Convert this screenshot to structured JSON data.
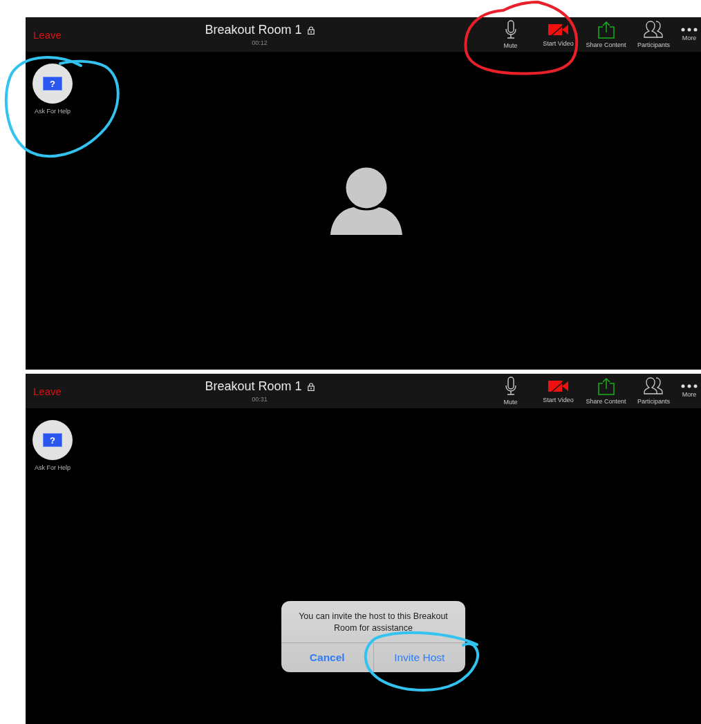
{
  "screens": [
    {
      "leave": "Leave",
      "title": "Breakout Room 1",
      "timer": "00:12",
      "locked": true,
      "toolbar": [
        {
          "kind": "mic",
          "label": "Mute"
        },
        {
          "kind": "video",
          "label": "Start Video"
        },
        {
          "kind": "share",
          "label": "Share Content"
        },
        {
          "kind": "participants",
          "label": "Participants"
        },
        {
          "kind": "more",
          "label": "More"
        }
      ],
      "help_button": {
        "icon_text": "?",
        "label": "Ask For Help"
      },
      "annotations": [
        {
          "kind": "toolbar",
          "color": "#e8202a"
        },
        {
          "kind": "help",
          "color": "#33c3f0"
        }
      ]
    },
    {
      "leave": "Leave",
      "title": "Breakout Room 1",
      "timer": "00:31",
      "locked": true,
      "toolbar": [
        {
          "kind": "mic",
          "label": "Mute"
        },
        {
          "kind": "video",
          "label": "Start Video"
        },
        {
          "kind": "share",
          "label": "Share Content"
        },
        {
          "kind": "participants",
          "label": "Participants"
        },
        {
          "kind": "more",
          "label": "More"
        }
      ],
      "help_button": {
        "icon_text": "?",
        "label": "Ask For Help"
      },
      "dialog": {
        "message": "You can invite the host to this Breakout Room for assistance",
        "buttons": [
          "Cancel",
          "Invite Host"
        ]
      },
      "annotations": [
        {
          "kind": "invite",
          "color": "#33c3f0"
        }
      ]
    }
  ]
}
